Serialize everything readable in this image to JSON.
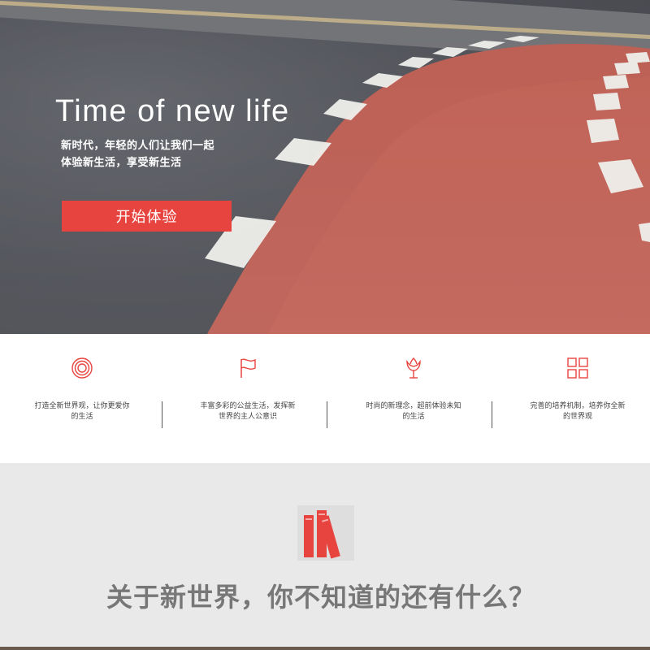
{
  "hero": {
    "title": "Time of new life",
    "subtitle_line1": "新时代，年轻的人们让我们一起",
    "subtitle_line2": "体验新生活，享受新生活",
    "cta_label": "开始体验"
  },
  "features": [
    {
      "icon": "target-icon",
      "text": "打造全新世界观，让你更爱你的生活"
    },
    {
      "icon": "flag-icon",
      "text": "丰富多彩的公益生活，发挥新世界的主人公意识"
    },
    {
      "icon": "tulip-icon",
      "text": "时尚的新理念，超前体验未知的生活"
    },
    {
      "icon": "grid-icon",
      "text": "完善的培养机制，培养你全新的世界观"
    }
  ],
  "about": {
    "icon": "books-icon",
    "title": "关于新世界，你不知道的还有什么？"
  },
  "colors": {
    "accent": "#e8443f",
    "track": "#b9554a",
    "asphalt": "#4a4b52",
    "about_bg": "#e9e9e9"
  }
}
